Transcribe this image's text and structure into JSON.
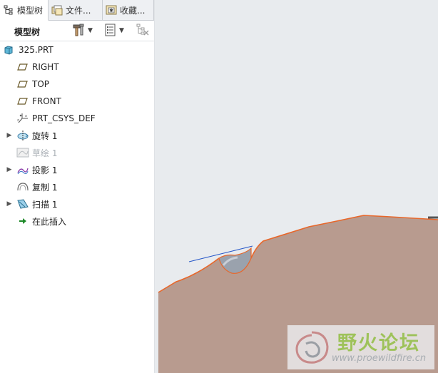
{
  "tabs": [
    {
      "label": "模型树",
      "icon": "model-tree-icon",
      "active": true
    },
    {
      "label": "文件...",
      "icon": "folder-icon",
      "active": false
    },
    {
      "label": "收藏...",
      "icon": "favorites-icon",
      "active": false
    }
  ],
  "toolbar": {
    "title": "模型树",
    "settings_icon": "tree-settings-icon",
    "show_icon": "tree-show-icon",
    "filter_icon": "tree-filter-icon"
  },
  "tree": {
    "items": [
      {
        "label": "325.PRT",
        "icon": "part-icon",
        "expandable": false,
        "dimmed": false
      },
      {
        "label": "RIGHT",
        "icon": "datum-plane-icon",
        "expandable": false,
        "dimmed": false
      },
      {
        "label": "TOP",
        "icon": "datum-plane-icon",
        "expandable": false,
        "dimmed": false
      },
      {
        "label": "FRONT",
        "icon": "datum-plane-icon",
        "expandable": false,
        "dimmed": false
      },
      {
        "label": "PRT_CSYS_DEF",
        "icon": "coordinate-system-icon",
        "expandable": false,
        "dimmed": false
      },
      {
        "label": "旋转 1",
        "icon": "revolve-icon",
        "expandable": true,
        "dimmed": false
      },
      {
        "label": "草绘 1",
        "icon": "sketch-icon",
        "expandable": false,
        "dimmed": true
      },
      {
        "label": "投影 1",
        "icon": "projection-icon",
        "expandable": true,
        "dimmed": false
      },
      {
        "label": "复制 1",
        "icon": "copy-surface-icon",
        "expandable": false,
        "dimmed": false
      },
      {
        "label": "扫描 1",
        "icon": "sweep-icon",
        "expandable": true,
        "dimmed": false
      },
      {
        "label": "在此插入",
        "icon": "insert-here-arrow-icon",
        "expandable": false,
        "dimmed": false
      }
    ]
  },
  "watermark": {
    "title": "野火论坛",
    "url": "www.proewildfire.cn"
  },
  "colors": {
    "model_fill": "#b89b8f",
    "model_edge": "#e8672a",
    "background": "#e8ebee",
    "curve_blue": "#2456c8"
  }
}
